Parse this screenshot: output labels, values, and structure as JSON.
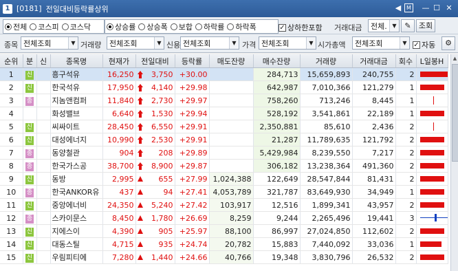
{
  "window": {
    "num": "1",
    "code": "[0181]",
    "title": "전일대비등락률상위"
  },
  "filters": {
    "market": [
      {
        "label": "전체",
        "on": true
      },
      {
        "label": "코스피",
        "on": false
      },
      {
        "label": "코스닥",
        "on": false
      }
    ],
    "type": [
      {
        "label": "상승률",
        "on": true
      },
      {
        "label": "상승폭",
        "on": false
      },
      {
        "label": "보합",
        "on": false
      },
      {
        "label": "하락률",
        "on": false
      },
      {
        "label": "하락폭",
        "on": false
      }
    ],
    "limit_include_label": "상하한포함",
    "trade_amount_label": "거래대금",
    "trade_amount_value": "전체.",
    "query_label": "조회",
    "stock_label": "종목",
    "stock_value": "전체조회",
    "volume_label": "거래량",
    "volume_value": "전체조회",
    "credit_label": "신용",
    "credit_value": "전체조회",
    "price_label": "가격",
    "price_value": "전체조회",
    "mcap_label": "시가총액",
    "mcap_value": "전체조회",
    "auto_label": "자동"
  },
  "columns": [
    "순위",
    "분",
    "신",
    "종목명",
    "현재가",
    "전일대비",
    "등락률",
    "매도잔량",
    "매수잔량",
    "거래량",
    "거래대금",
    "회수",
    "L일봉H"
  ],
  "rows": [
    {
      "rank": "1",
      "mkt": "신",
      "mtype": "k",
      "name": "흥구석유",
      "price": "16,250",
      "chg": "3,750",
      "rate": "+30.00",
      "sell": "",
      "buy": "284,713",
      "vol": "15,659,893",
      "amt": "240,755",
      "cnt": "2",
      "bar": 0.9,
      "selected": true,
      "limit": true
    },
    {
      "rank": "2",
      "mkt": "신",
      "mtype": "k",
      "name": "한국석유",
      "price": "17,950",
      "chg": "4,140",
      "rate": "+29.98",
      "sell": "",
      "buy": "642,987",
      "vol": "7,010,366",
      "amt": "121,279",
      "cnt": "1",
      "bar": 0.8
    },
    {
      "rank": "3",
      "mkt": "종",
      "mtype": "q",
      "name": "지놈앤컴퍼",
      "price": "11,840",
      "chg": "2,730",
      "rate": "+29.97",
      "sell": "",
      "buy": "758,260",
      "vol": "713,246",
      "amt": "8,445",
      "cnt": "1",
      "bar": 0
    },
    {
      "rank": "4",
      "mkt": "",
      "mtype": "",
      "name": "화성밸브",
      "price": "6,640",
      "chg": "1,530",
      "rate": "+29.94",
      "sell": "",
      "buy": "528,192",
      "vol": "3,541,861",
      "amt": "22,189",
      "cnt": "1",
      "bar": 0.8
    },
    {
      "rank": "5",
      "mkt": "신",
      "mtype": "k",
      "name": "씨싸이트",
      "price": "28,450",
      "chg": "6,550",
      "rate": "+29.91",
      "sell": "",
      "buy": "2,350,881",
      "vol": "85,610",
      "amt": "2,436",
      "cnt": "2",
      "bar": 0
    },
    {
      "rank": "6",
      "mkt": "신",
      "mtype": "k",
      "name": "대성에너지",
      "price": "10,990",
      "chg": "2,530",
      "rate": "+29.91",
      "sell": "",
      "buy": "21,287",
      "vol": "11,789,635",
      "amt": "121,792",
      "cnt": "2",
      "bar": 0.8
    },
    {
      "rank": "7",
      "mkt": "종",
      "mtype": "q",
      "name": "동양철관",
      "price": "904",
      "chg": "208",
      "rate": "+29.89",
      "sell": "",
      "buy": "5,429,984",
      "vol": "8,239,550",
      "amt": "7,217",
      "cnt": "2",
      "bar": 0.8
    },
    {
      "rank": "8",
      "mkt": "종",
      "mtype": "q",
      "name": "한국가스공",
      "price": "38,700",
      "chg": "8,900",
      "rate": "+29.87",
      "sell": "",
      "buy": "306,182",
      "vol": "13,238,364",
      "amt": "491,360",
      "cnt": "2",
      "bar": 0.8
    },
    {
      "rank": "9",
      "mkt": "신",
      "mtype": "k",
      "name": "동방",
      "price": "2,995",
      "chg": "655",
      "rate": "+27.99",
      "sell": "1,024,388",
      "buy": "122,649",
      "vol": "28,547,844",
      "amt": "81,431",
      "cnt": "2",
      "bar": 0.8,
      "open": true
    },
    {
      "rank": "10",
      "mkt": "종",
      "mtype": "q",
      "name": "한국ANKOR유",
      "price": "437",
      "chg": "94",
      "rate": "+27.41",
      "sell": "4,053,789",
      "buy": "321,787",
      "vol": "83,649,930",
      "amt": "34,949",
      "cnt": "1",
      "bar": 0.8,
      "open": true
    },
    {
      "rank": "11",
      "mkt": "신",
      "mtype": "k",
      "name": "중앙에너비",
      "price": "24,350",
      "chg": "5,240",
      "rate": "+27.42",
      "sell": "103,917",
      "buy": "12,516",
      "vol": "1,899,341",
      "amt": "43,957",
      "cnt": "2",
      "bar": 0.8,
      "open": true
    },
    {
      "rank": "12",
      "mkt": "종",
      "mtype": "q",
      "name": "스카이문스",
      "price": "8,450",
      "chg": "1,780",
      "rate": "+26.69",
      "sell": "8,259",
      "buy": "9,244",
      "vol": "2,265,496",
      "amt": "19,441",
      "cnt": "3",
      "bar": 0,
      "cross": true,
      "open": true
    },
    {
      "rank": "13",
      "mkt": "신",
      "mtype": "k",
      "name": "지에스이",
      "price": "4,390",
      "chg": "905",
      "rate": "+25.97",
      "sell": "88,100",
      "buy": "86,997",
      "vol": "27,024,850",
      "amt": "112,602",
      "cnt": "2",
      "bar": 0.8,
      "open": true
    },
    {
      "rank": "14",
      "mkt": "신",
      "mtype": "k",
      "name": "대동스틸",
      "price": "4,715",
      "chg": "935",
      "rate": "+24.74",
      "sell": "20,782",
      "buy": "15,883",
      "vol": "7,440,092",
      "amt": "33,036",
      "cnt": "1",
      "bar": 0.7,
      "open": true
    },
    {
      "rank": "15",
      "mkt": "신",
      "mtype": "k",
      "name": "우림피티에",
      "price": "7,280",
      "chg": "1,440",
      "rate": "+24.66",
      "sell": "40,766",
      "buy": "19,348",
      "vol": "3,830,796",
      "amt": "26,532",
      "cnt": "2",
      "bar": 0.8,
      "open": true
    }
  ]
}
